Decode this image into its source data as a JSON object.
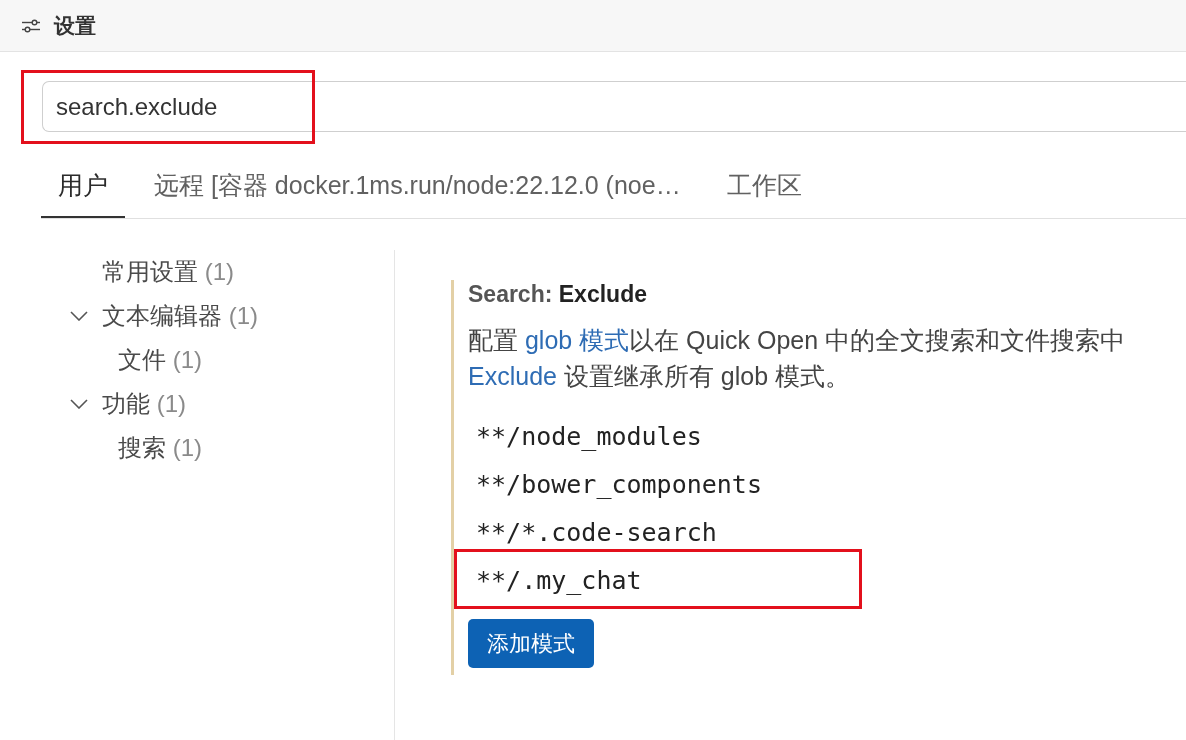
{
  "header": {
    "title": "设置"
  },
  "search": {
    "value": "search.exclude",
    "highlighted": true
  },
  "tabs": [
    {
      "label": "用户",
      "selected": true
    },
    {
      "label": "远程 [容器 docker.1ms.run/node:22.12.0 (noe…",
      "selected": false
    },
    {
      "label": "工作区",
      "selected": false
    }
  ],
  "toc": [
    {
      "label": "常用设置",
      "count": "(1)"
    },
    {
      "label": "文本编辑器",
      "count": "(1)",
      "expanded": true,
      "children": [
        {
          "label": "文件",
          "count": "(1)"
        }
      ]
    },
    {
      "label": "功能",
      "count": "(1)",
      "expanded": true,
      "children": [
        {
          "label": "搜索",
          "count": "(1)"
        }
      ]
    }
  ],
  "setting": {
    "modified": true,
    "category": "Search:",
    "name": "Exclude",
    "description_lines": [
      {
        "segments": [
          {
            "text": "配置 ",
            "link": false
          },
          {
            "text": "glob 模式",
            "link": true
          },
          {
            "text": "以在 Quick Open 中的全文搜索和文件搜索中",
            "link": false
          }
        ]
      },
      {
        "segments": [
          {
            "text": "Exclude",
            "link": true
          },
          {
            "text": " 设置继承所有 glob 模式。",
            "link": false
          }
        ]
      }
    ],
    "patterns": [
      {
        "text": "**/node_modules",
        "highlighted": false
      },
      {
        "text": "**/bower_components",
        "highlighted": false
      },
      {
        "text": "**/*.code-search",
        "highlighted": false
      },
      {
        "text": "**/.my_chat",
        "highlighted": true
      }
    ],
    "add_button": "添加模式"
  }
}
